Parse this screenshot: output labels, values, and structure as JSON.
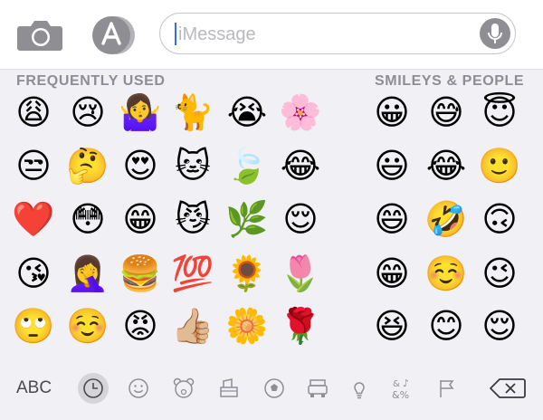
{
  "input": {
    "placeholder": "iMessage",
    "value": ""
  },
  "sections": {
    "frequent": "FREQUENTLY USED",
    "smileys": "SMILEYS & PEOPLE"
  },
  "frequent_emojis": [
    [
      "😩",
      "😢",
      "🤷‍♀️",
      "🐈",
      "😭",
      "🌸"
    ],
    [
      "😒",
      "🤔",
      "😍",
      "🐱",
      "🍃",
      "😂"
    ],
    [
      "❤️",
      "😳",
      "😁",
      "😼",
      "🌿",
      "😌"
    ],
    [
      "😘",
      "🤦‍♀️",
      "🍔",
      "💯",
      "🌻",
      "🌷"
    ],
    [
      "🙄",
      "☺️",
      "😡",
      "👍🏼",
      "🌼",
      "🌹"
    ]
  ],
  "smiley_emojis": [
    [
      "😀",
      "😅",
      "😇"
    ],
    [
      "😃",
      "😂",
      "🙂"
    ],
    [
      "😄",
      "🤣",
      "🙃"
    ],
    [
      "😁",
      "☺️",
      "😉"
    ],
    [
      "😆",
      "😊",
      "😌"
    ]
  ],
  "bottom": {
    "abc_label": "ABC"
  },
  "colors": {
    "accent": "#2f6df6",
    "keyboard_bg": "#f1f1f5",
    "icon_gray": "#8e8e93",
    "heart_red": "#e0212b"
  }
}
